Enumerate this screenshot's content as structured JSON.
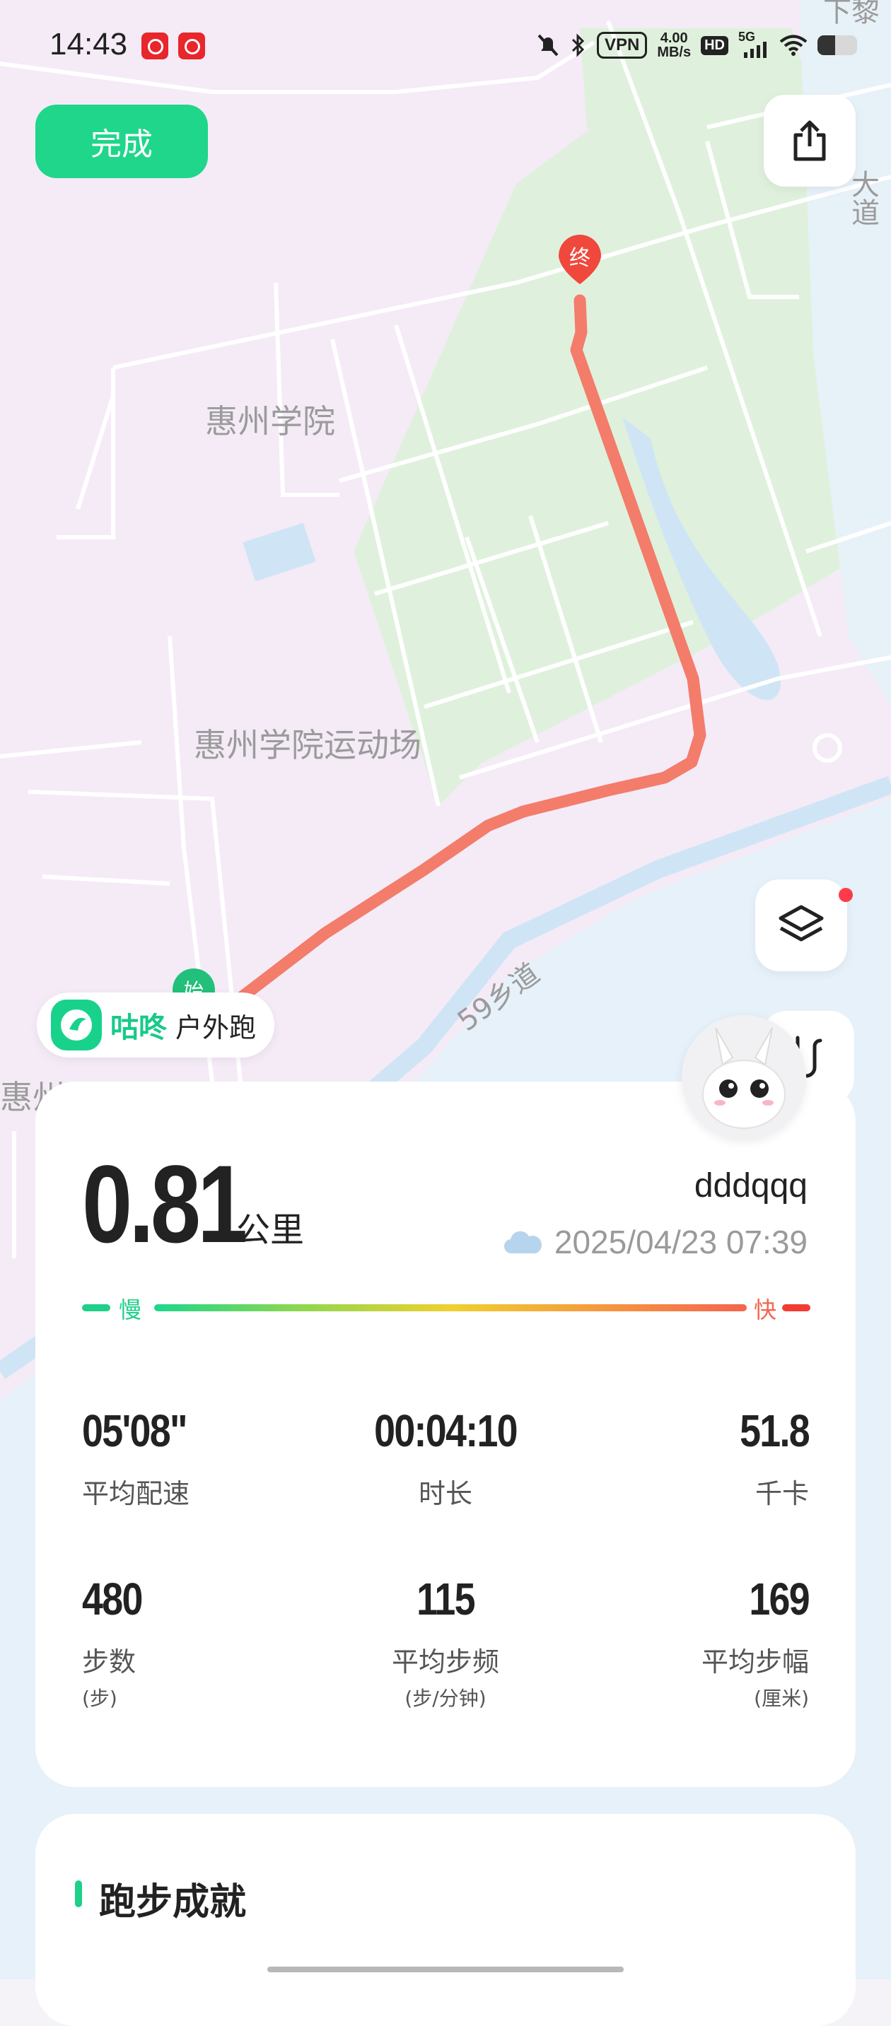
{
  "status_bar": {
    "time": "14:43",
    "network_speed": "4.00",
    "network_speed_unit": "MB/s",
    "vpn": "VPN",
    "hd": "HD",
    "signal": "5G",
    "battery_level": 0.45
  },
  "map": {
    "labels": {
      "xialu": "下黎",
      "dadao": "大道",
      "school": "惠州学院",
      "stadium": "惠州学院运动场",
      "road": "59乡道",
      "huizhou": "惠州"
    },
    "start_marker": "始",
    "end_marker": "终",
    "colors": {
      "route": "#f37c6b",
      "green": "#dff1dc",
      "land": "#f4ebf7",
      "water": "#cfe5f5"
    }
  },
  "toolbar": {
    "done_label": "完成"
  },
  "brand": {
    "name": "咕咚",
    "activity_type": "户外跑"
  },
  "summary": {
    "distance": "0.81",
    "distance_unit": "公里",
    "username": "dddqqq",
    "datetime": "2025/04/23 07:39",
    "pace_slow": "慢",
    "pace_fast": "快"
  },
  "stats": [
    {
      "value": "05'08\"",
      "label": "平均配速",
      "unit": ""
    },
    {
      "value": "00:04:10",
      "label": "时长",
      "unit": ""
    },
    {
      "value": "51.8",
      "label": "千卡",
      "unit": ""
    },
    {
      "value": "480",
      "label": "步数",
      "unit": "(步)"
    },
    {
      "value": "115",
      "label": "平均步频",
      "unit": "(步/分钟)"
    },
    {
      "value": "169",
      "label": "平均步幅",
      "unit": "(厘米)"
    }
  ],
  "achievements": {
    "title": "跑步成就"
  }
}
